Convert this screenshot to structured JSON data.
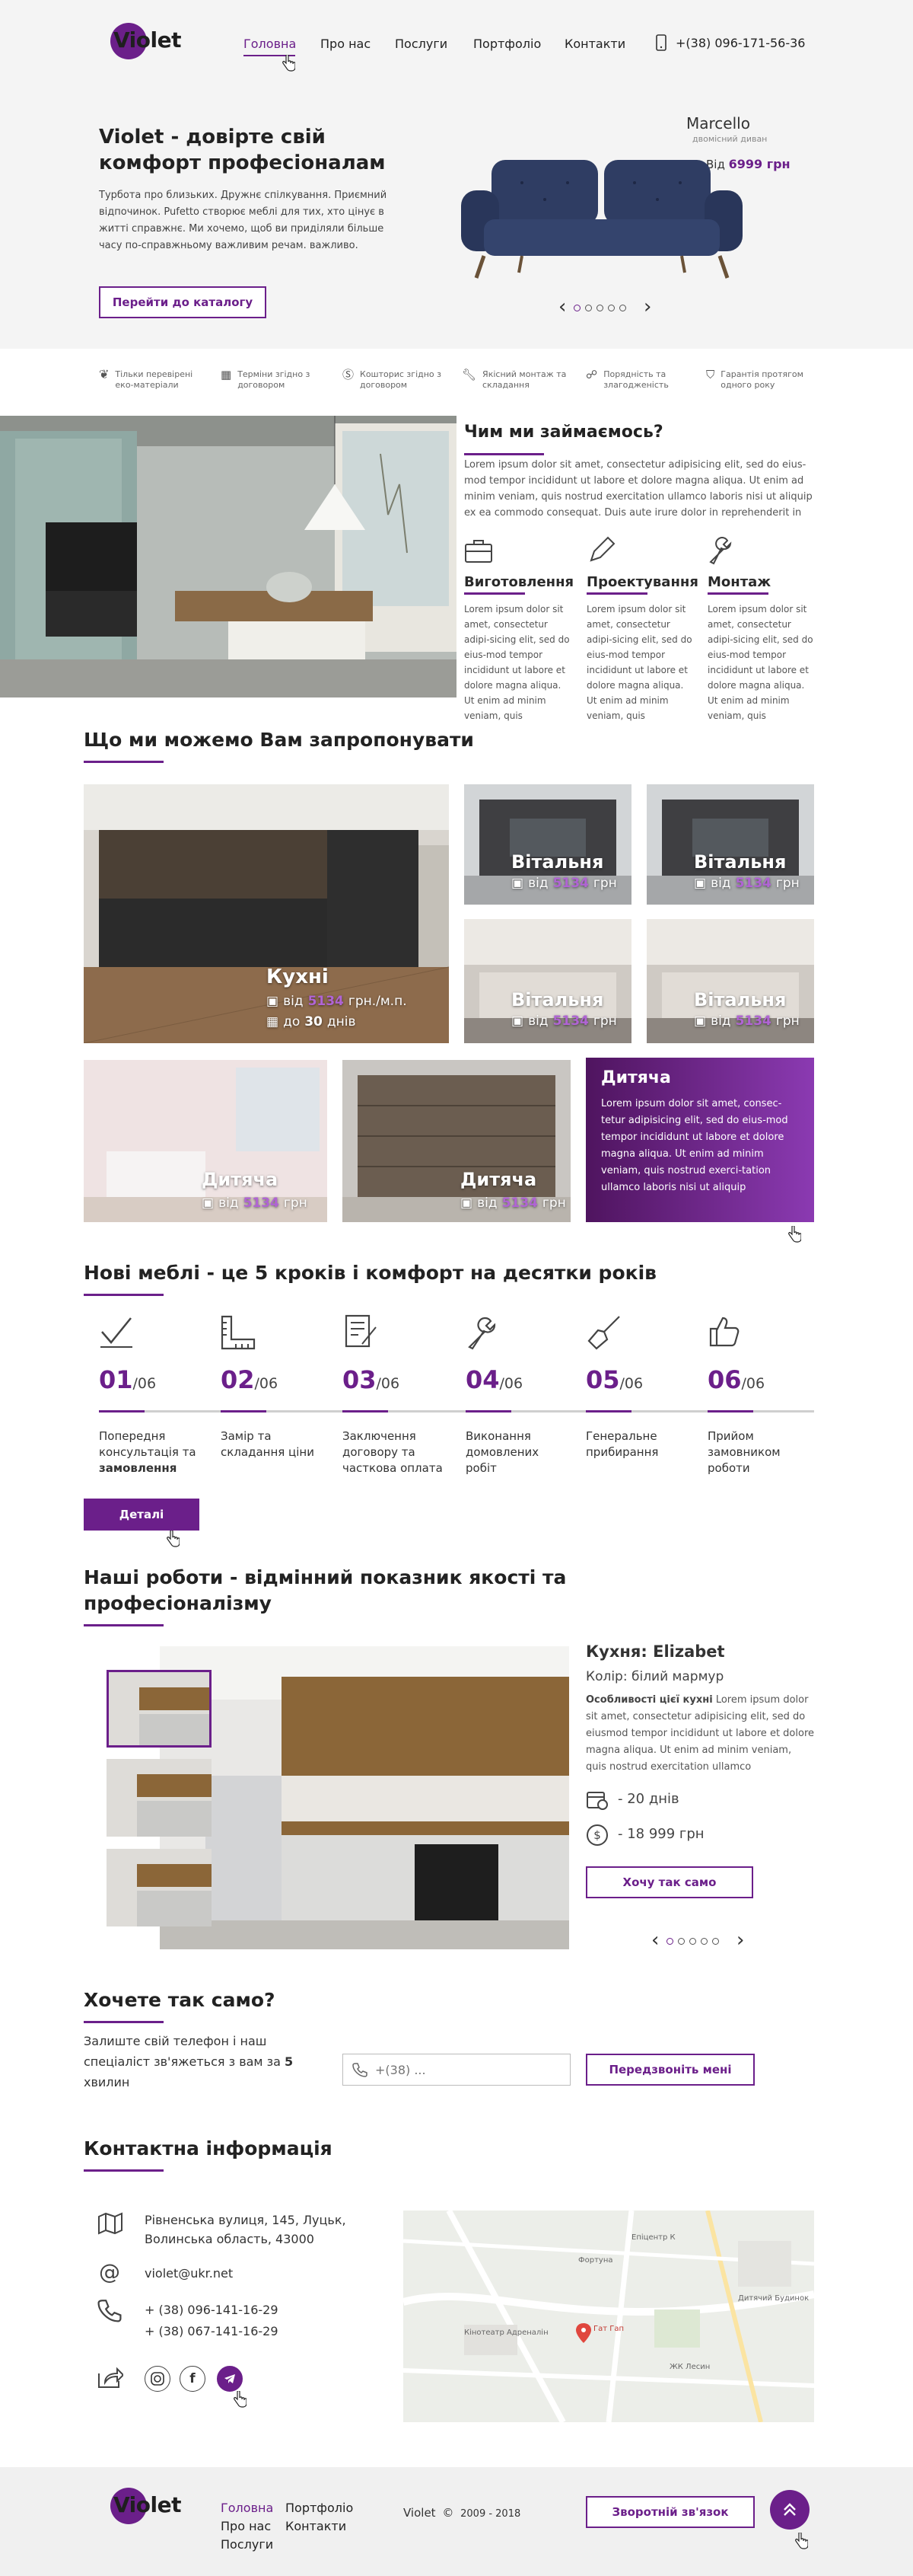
{
  "brand": {
    "name": "Violet",
    "accent": "#6b1f8a"
  },
  "nav": {
    "items": [
      "Головна",
      "Про нас",
      "Послуги",
      "Портфоліо",
      "Контакти"
    ],
    "phone": "+(38) 096-171-56-36"
  },
  "hero": {
    "title": "Violet - довірте свій комфорт професіоналам",
    "text": "Турбота про близьких. Дружнє спілкування. Приємний відпочинок. Pufetto створює меблі для тих, хто цінує в житті справжнє. Ми хочемо, щоб ви приділяли більше часу по-справжньому важливим речам. важливо.",
    "cta": "Перейти до каталогу",
    "product_name": "Marcello",
    "product_sub": "двомісний диван",
    "price_prefix": "Від",
    "price": "6999 грн",
    "slider_prev": "‹",
    "slider_next": "›"
  },
  "features": [
    "Тільки перевірені еко-матеріали",
    "Терміни згідно з договором",
    "Кошторис згідно з договором",
    "Якісний монтаж та складання",
    "Порядність та злагодженість",
    "Гарантія протягом одного року"
  ],
  "about": {
    "title": "Чим ми займаємось?",
    "text": "Lorem ipsum dolor sit amet, consectetur adipisicing elit, sed do eius-mod tempor incididunt ut labore et dolore magna aliqua. Ut enim ad minim veniam, quis nostrud exercitation ullamco laboris nisi ut aliquip ex ea commodo consequat. Duis aute irure dolor in reprehenderit in",
    "services": [
      {
        "title": "Виготовлення",
        "text": "Lorem ipsum dolor sit amet, consectetur adipi-sicing elit, sed do eius-mod tempor incididunt ut labore et dolore magna aliqua. Ut enim ad minim veniam, quis"
      },
      {
        "title": "Проектування",
        "text": "Lorem ipsum dolor sit amet, consectetur adipi-sicing elit, sed do eius-mod tempor incididunt ut labore et dolore magna aliqua. Ut enim ad minim veniam, quis"
      },
      {
        "title": "Монтаж",
        "text": "Lorem ipsum dolor sit amet, consectetur adipi-sicing elit, sed do eius-mod tempor incididunt ut labore et dolore magna aliqua. Ut enim ad minim veniam, quis"
      }
    ]
  },
  "offer": {
    "title": "Що ми можемо Вам запропонувати",
    "kitchen": {
      "title": "Кухні",
      "price_prefix": "від",
      "price": "5134",
      "price_unit": "грн./м.п.",
      "days_prefix": "до",
      "days": "30",
      "days_unit": "днів"
    },
    "living": {
      "title": "Вітальня",
      "price_prefix": "від",
      "price": "5134",
      "unit": "грн"
    },
    "kids": {
      "title": "Дитяча",
      "price_prefix": "від",
      "price": "5134",
      "unit": "грн"
    },
    "promo": {
      "title": "Дитяча",
      "text": "Lorem ipsum dolor sit amet, consec-tetur adipisicing elit, sed do eius-mod tempor incididunt ut labore et dolore magna aliqua. Ut enim ad minim veniam, quis nostrud exerci-tation ullamco laboris nisi ut aliquip"
    }
  },
  "steps": {
    "title": "Нові меблі - це 5 кроків і комфорт на десятки років",
    "total": "/06",
    "items": [
      {
        "num": "01",
        "text": "Попередня консультація та",
        "bold": "замовлення"
      },
      {
        "num": "02",
        "text": "Замір та складання ціни",
        "bold": ""
      },
      {
        "num": "03",
        "text": "Заключення договору та часткова оплата",
        "bold": ""
      },
      {
        "num": "04",
        "text": "Виконання домовлених робіт",
        "bold": ""
      },
      {
        "num": "05",
        "text": "Генеральне прибирання",
        "bold": ""
      },
      {
        "num": "06",
        "text": "Прийом замовником роботи",
        "bold": ""
      }
    ],
    "button": "Деталі"
  },
  "works": {
    "title": "Наші роботи - відмінний показник якості та професіоналізму",
    "project": "Кухня: Elizabet",
    "color": "Колір: білий мармур",
    "feature_label": "Особливості цієї кухні",
    "text": "Lorem ipsum dolor sit amet, consectetur adipisicing elit, sed do eiusmod tempor incididunt ut labore et dolore magna aliqua. Ut enim ad minim veniam, quis nostrud exercitation ullamco",
    "days": "- 20 днів",
    "price": "- 18 999 грн",
    "button": "Хочу так само"
  },
  "callback": {
    "title": "Хочете так само?",
    "text": "Залиште свій телефон і наш спеціаліст зв'яжеться з вам за",
    "minutes": "5",
    "minutes_unit": "хвилин",
    "placeholder": "+(38) ...",
    "button": "Передзвоніть мені"
  },
  "contacts": {
    "title": "Контактна інформація",
    "address": "Рівненська вулиця, 145, Луцьк, Волинська область, 43000",
    "email": "violet@ukr.net",
    "phone1": "+ (38) 096-141-16-29",
    "phone2": "+ (38) 067-141-16-29",
    "map_labels": [
      "Гат Гап",
      "Фортуна",
      "Епіцентр К",
      "Кінотеатр Адреналін",
      "ЖК Лесин",
      "Дитячий Будинок"
    ]
  },
  "footer": {
    "links": [
      "Головна",
      "Портфоліо",
      "Про нас",
      "Контакти",
      "Послуги"
    ],
    "copyright": "Violet",
    "years": "2009 - 2018",
    "button": "Зворотній зв'язок"
  }
}
